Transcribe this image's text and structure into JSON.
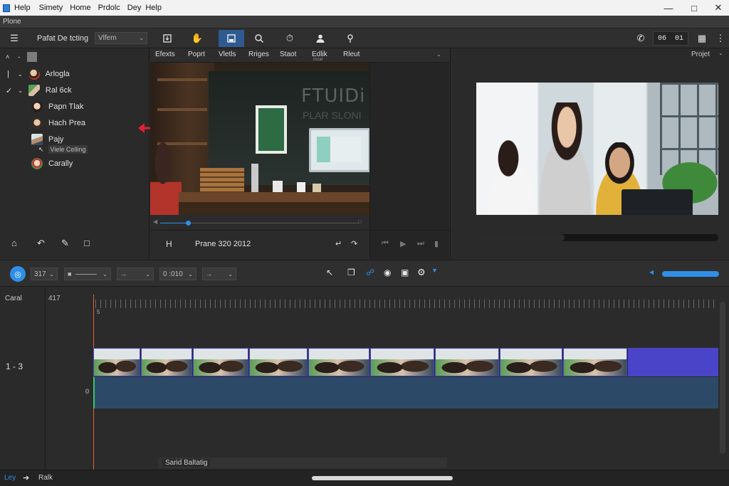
{
  "titlebar": {
    "menus": [
      "Help",
      "Simety",
      "Home",
      "Prdolc",
      "Dey",
      "Help"
    ]
  },
  "subtitle": "Plone",
  "toolbar": {
    "project_name": "Pafat De tcting",
    "view_dropdown": "Vlfem",
    "counter_a": "06",
    "counter_b": "01"
  },
  "left_panel": {
    "items": [
      {
        "label": "Arlogla"
      },
      {
        "label": "Ral 6ck"
      },
      {
        "label": "Papn Tlak"
      },
      {
        "label": "Hach Prea"
      },
      {
        "label": "Pajy"
      },
      {
        "label": "Viele Celling"
      },
      {
        "label": "Carally"
      }
    ]
  },
  "panel_tabs": [
    "Efexts",
    "Poprt",
    "Vletls",
    "Rriges",
    "Staot",
    "Edlik",
    "Rleut"
  ],
  "panel_tab_sub": "rnzal",
  "viewer_label": "Projet",
  "scene_board_text": [
    "FTUIDi",
    "PLAR SLONI"
  ],
  "frame_info": "Prane 320 2012",
  "ctrlbar": {
    "field_a": "317",
    "field_b": "0 :010"
  },
  "timeline": {
    "track_label": "Caral",
    "ruler_start": "417",
    "ruler_mark": "5",
    "track_index": "1 - 3",
    "audio_index": "0",
    "clip_label": "Sarid Baltatig"
  },
  "statusbar": {
    "left": "Ley",
    "right": "Ralk"
  },
  "colors": {
    "accent": "#2f8fe8",
    "clip_border": "#4a44c9",
    "audio_track": "#2c4a67",
    "playhead": "#e0622c"
  }
}
